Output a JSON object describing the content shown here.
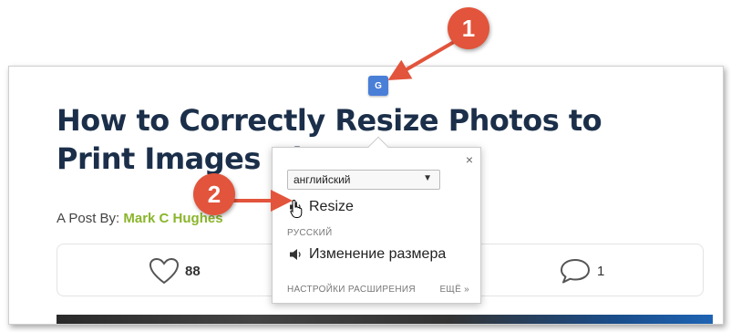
{
  "article": {
    "title": "How to Correctly Resize Photos to Print Images Big",
    "byline_prefix": "A Post By: ",
    "author": "Mark C Hughes",
    "like_count": "88",
    "comment_count": "1"
  },
  "translate_button": {
    "icon": "google-translate-icon",
    "glyph": "G"
  },
  "translate_popup": {
    "source_language": "английский",
    "source_word": "Resize",
    "target_language": "РУССКИЙ",
    "translation": "Изменение размера",
    "close_glyph": "×",
    "settings_link": "НАСТРОЙКИ РАСШИРЕНИЯ",
    "more_link": "ЕЩЁ »"
  },
  "annotations": {
    "marker_1": "1",
    "marker_2": "2",
    "color": "#e2543b"
  },
  "colors": {
    "title": "#1b2f4a",
    "author": "#8ab52b",
    "translate_icon": "#4a7fd8"
  }
}
